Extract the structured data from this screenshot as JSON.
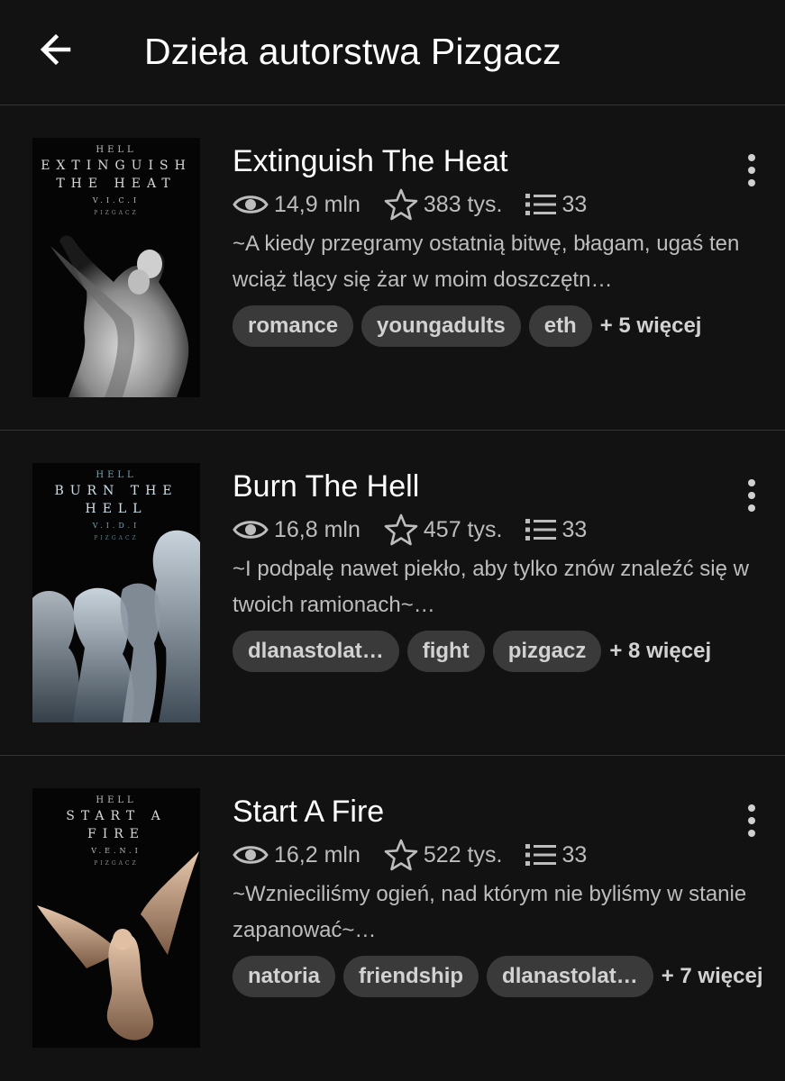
{
  "header": {
    "title": "Dzieła autorstwa Pizgacz"
  },
  "stories": [
    {
      "title": "Extinguish The Heat",
      "reads": "14,9 mln",
      "votes": "383 tys.",
      "parts": "33",
      "description": "~A kiedy przegramy ostatnią bitwę, błagam, ugaś ten wciąż tlący się żar w moim doszczętn…",
      "tags": [
        "romance",
        "youngadults",
        "eth"
      ],
      "more_tags": "+ 5 więcej",
      "cover": {
        "hell": "HELL",
        "title": "EXTINGUISH THE HEAT",
        "code": "V.I.C.I",
        "author": "PIZGACZ"
      }
    },
    {
      "title": "Burn The Hell",
      "reads": "16,8 mln",
      "votes": "457 tys.",
      "parts": "33",
      "description": "~I podpalę nawet piekło, aby tylko znów znaleźć się w twoich ramionach~…",
      "tags": [
        "dlanastolat…",
        "fight",
        "pizgacz"
      ],
      "more_tags": "+ 8 więcej",
      "cover": {
        "hell": "HELL",
        "title": "BURN THE HELL",
        "code": "V.I.D.I",
        "author": "PIZGACZ"
      }
    },
    {
      "title": "Start A Fire",
      "reads": "16,2 mln",
      "votes": "522 tys.",
      "parts": "33",
      "description": "~Wznieciliśmy ogień, nad którym nie byliśmy w stanie zapanować~…",
      "tags": [
        "natoria",
        "friendship",
        "dlanastolat…"
      ],
      "more_tags": "+ 7 więcej",
      "cover": {
        "hell": "HELL",
        "title": "START A FIRE",
        "code": "V.E.N.I",
        "author": "PIZGACZ"
      }
    }
  ],
  "icons": {
    "back": "arrow-left-icon",
    "reads": "eye-icon",
    "votes": "star-icon",
    "parts": "list-icon",
    "menu": "more-vertical-icon"
  },
  "colors": {
    "background": "#121212",
    "tag_background": "#3a3a3a",
    "secondary_text": "#bdbdbd"
  }
}
